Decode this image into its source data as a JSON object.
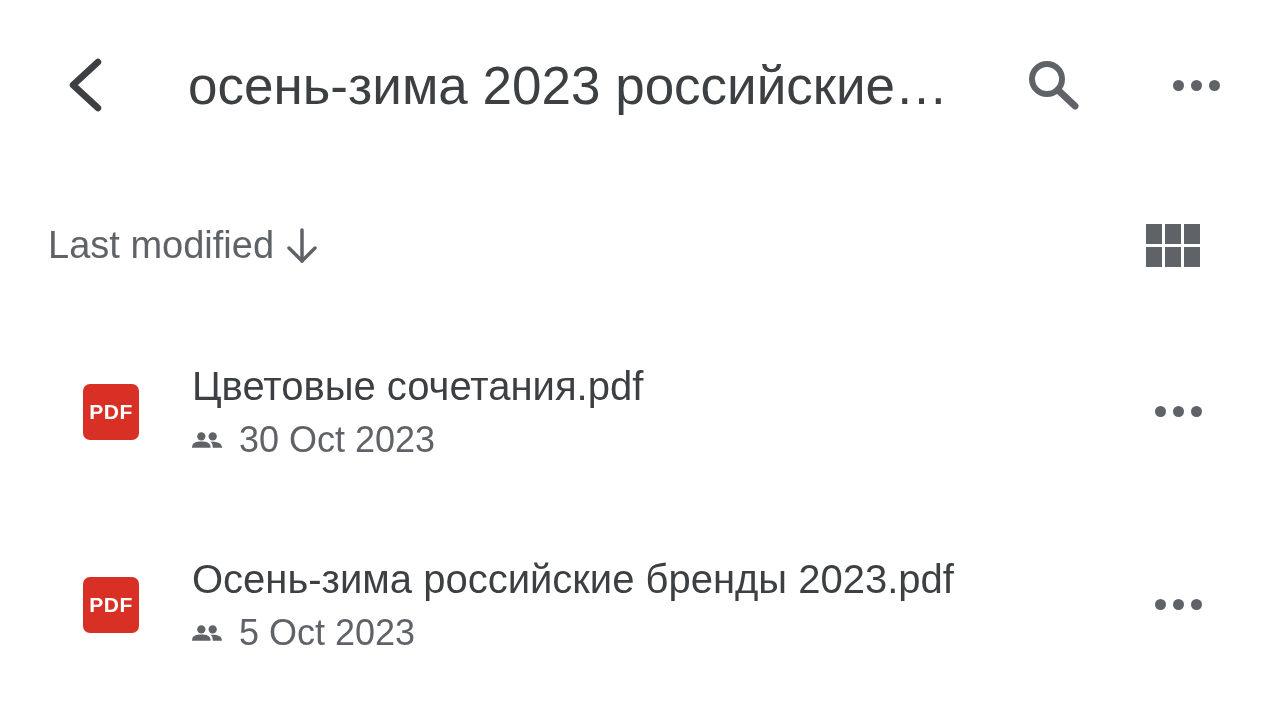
{
  "header": {
    "title": "осень-зима 2023 российские…"
  },
  "sort": {
    "label": "Last modified",
    "descending": true
  },
  "files": [
    {
      "name": "Цветовые сочетания.pdf",
      "type_label": "PDF",
      "shared": true,
      "modified": "30 Oct 2023"
    },
    {
      "name": "Осень-зима российские бренды 2023.pdf",
      "type_label": "PDF",
      "shared": true,
      "modified": "5 Oct 2023"
    }
  ]
}
